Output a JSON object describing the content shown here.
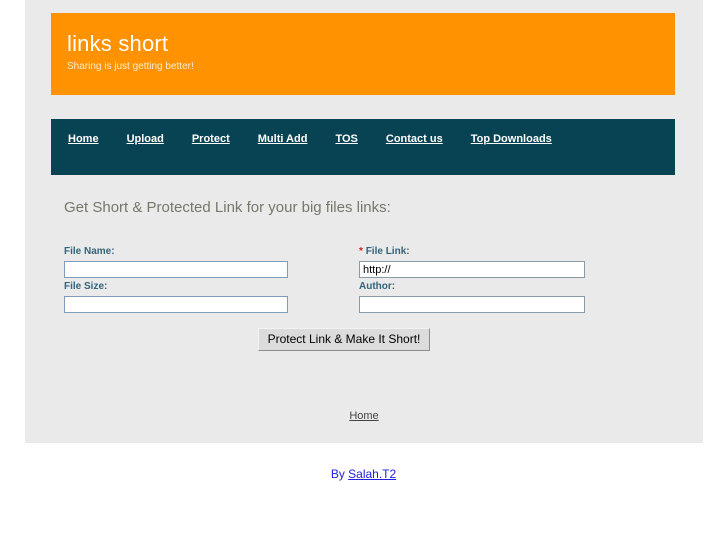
{
  "masthead": {
    "title": "links short",
    "tagline": "Sharing is just getting better!",
    "background_color": "#ff9200"
  },
  "nav": {
    "background_color": "#084354",
    "items": [
      {
        "label": "Home"
      },
      {
        "label": "Upload"
      },
      {
        "label": "Protect"
      },
      {
        "label": "Multi Add"
      },
      {
        "label": "TOS"
      },
      {
        "label": "Contact us"
      },
      {
        "label": "Top Downloads"
      }
    ]
  },
  "main": {
    "heading": "Get Short & Protected Link for your big files links:",
    "form": {
      "file_name": {
        "label": "File Name:",
        "value": "",
        "placeholder": ""
      },
      "file_link": {
        "required_marker": "*",
        "label": "File Link:",
        "value": "http://",
        "placeholder": ""
      },
      "file_size": {
        "label": "File Size:",
        "value": "",
        "placeholder": ""
      },
      "author": {
        "label": "Author:",
        "value": "",
        "placeholder": ""
      },
      "submit_label": "Protect Link & Make It Short!"
    }
  },
  "footer": {
    "home_link": "Home",
    "credit_prefix": "By ",
    "credit_link": "Salah.T2"
  }
}
